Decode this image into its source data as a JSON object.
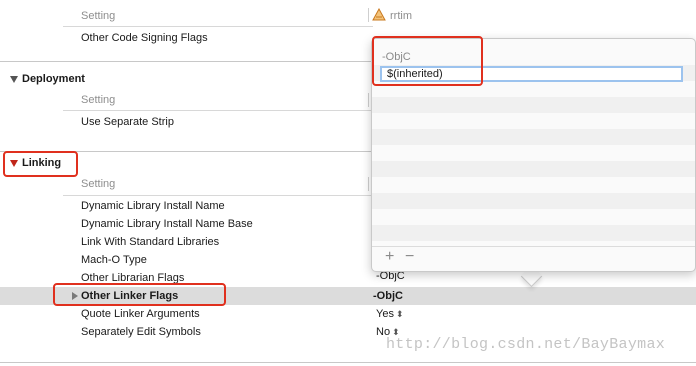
{
  "accent_color": "#e0301e",
  "code_signing": {
    "header_label": "Setting",
    "target_name": "rrtim",
    "target_icon": "app-target-icon",
    "row_label": "Other Code Signing Flags"
  },
  "deployment": {
    "title": "Deployment",
    "header_label": "Setting",
    "rows": [
      "Use Separate Strip"
    ]
  },
  "linking": {
    "title": "Linking",
    "header_label": "Setting",
    "rows": [
      {
        "label": "Dynamic Library Install Name",
        "value": ""
      },
      {
        "label": "Dynamic Library Install Name Base",
        "value": ""
      },
      {
        "label": "Link With Standard Libraries",
        "value": ""
      },
      {
        "label": "Mach-O Type",
        "value": ""
      },
      {
        "label": "Other Librarian Flags",
        "value": "-ObjC"
      },
      {
        "label": "Other Linker Flags",
        "value": "-ObjC"
      },
      {
        "label": "Quote Linker Arguments",
        "value": "Yes"
      },
      {
        "label": "Separately Edit Symbols",
        "value": "No"
      }
    ]
  },
  "popover": {
    "items": [
      "-ObjC"
    ],
    "edit_value": "$(inherited)",
    "add_label": "+",
    "remove_label": "−"
  },
  "watermark": "http://blog.csdn.net/BayBaymax"
}
